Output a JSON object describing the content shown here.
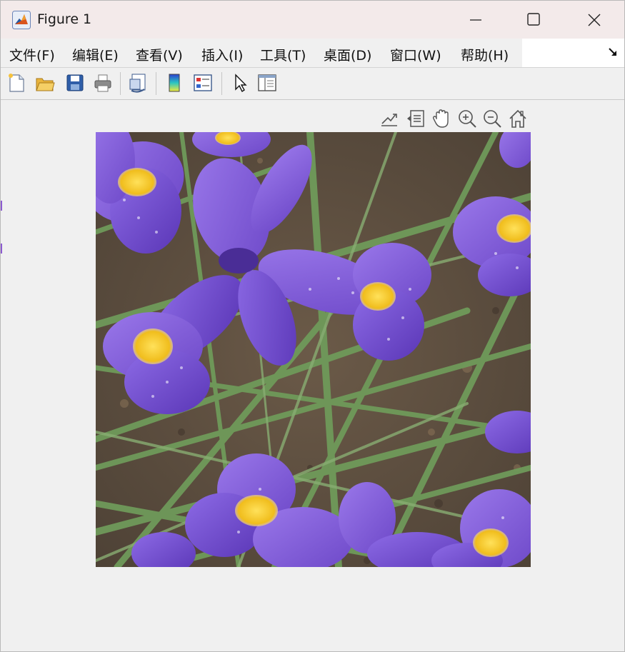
{
  "window": {
    "title": "Figure 1",
    "icon": "matlab-logo-icon"
  },
  "window_controls": [
    "minimize-icon",
    "maximize-icon",
    "close-icon"
  ],
  "menu": {
    "items": [
      {
        "label": "文件(F)"
      },
      {
        "label": "编辑(E)"
      },
      {
        "label": "查看(V)"
      },
      {
        "label": "插入(I)"
      },
      {
        "label": "工具(T)"
      },
      {
        "label": "桌面(D)"
      },
      {
        "label": "窗口(W)"
      },
      {
        "label": "帮助(H)"
      }
    ],
    "dock_icon": "dock-arrow-icon"
  },
  "toolbar": {
    "buttons": [
      "new-figure-icon",
      "open-file-icon",
      "save-icon",
      "print-icon",
      "link-plot-icon",
      "colorbar-icon",
      "legend-icon",
      "edit-plot-icon",
      "property-inspector-icon"
    ]
  },
  "axes_toolbar": {
    "buttons": [
      "export-icon",
      "data-tips-icon",
      "pan-icon",
      "zoom-in-icon",
      "zoom-out-icon",
      "home-icon"
    ]
  },
  "colors": {
    "titlebar": "#f3eaea",
    "window_bg": "#f0f0f0",
    "petal": "#7a55d8",
    "petal_dark": "#5a37b8",
    "yellow": "#f0c020",
    "leaf": "#5f8b4e",
    "ground": "#5c4b3d"
  },
  "image": {
    "description_icon": "iris-flower-photo"
  }
}
